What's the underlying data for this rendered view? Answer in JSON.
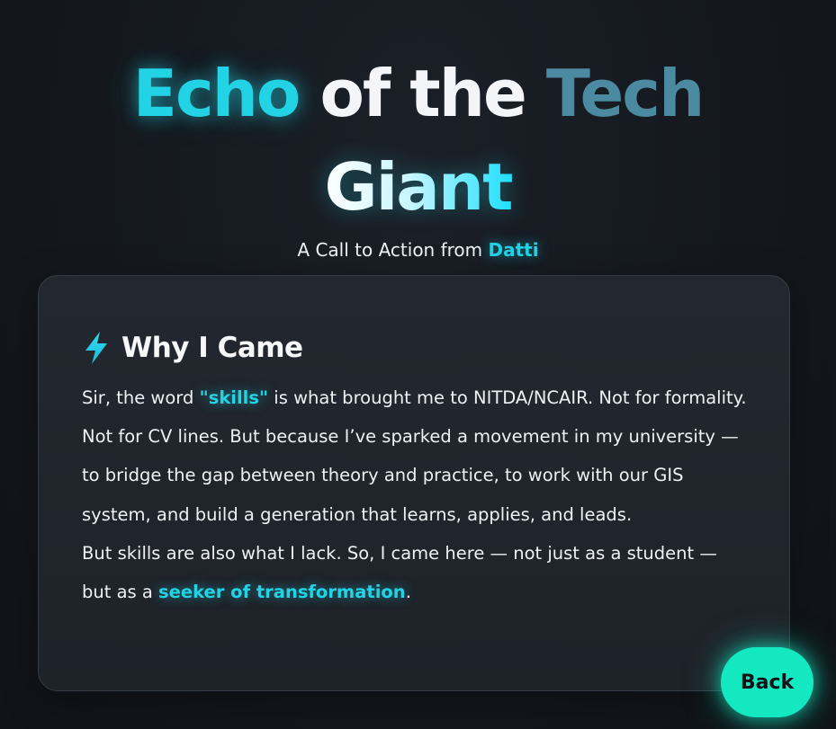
{
  "hero": {
    "title_word_1": "Echo",
    "title_word_2": "of the",
    "title_word_3": "Tech",
    "title_word_4": "Giant",
    "subtitle_prefix": "A Call to Action from ",
    "subtitle_name": "Datti"
  },
  "card": {
    "icon": "lightning-bolt-icon",
    "title": "Why I Came",
    "p1_part1": "Sir, the word ",
    "p1_highlight": "\"skills\"",
    "p1_part2": " is what brought me to NITDA/NCAIR. Not for formality. Not for CV lines. But because I’ve sparked a movement in my university — to bridge the gap between theory and practice, to work with our GIS system, and build a generation that learns, applies, and leads.",
    "p2_part1": "But skills are also what I lack. So, I came here — not just as a student — but as a ",
    "p2_highlight": "seeker of transformation",
    "p2_part2": "."
  },
  "actions": {
    "back_label": "Back"
  },
  "colors": {
    "accent_cyan": "#22d3e6",
    "muted_teal": "#4b8aa0",
    "button_green": "#14e8c0",
    "background": "#14181e",
    "card_background": "#22272e"
  }
}
